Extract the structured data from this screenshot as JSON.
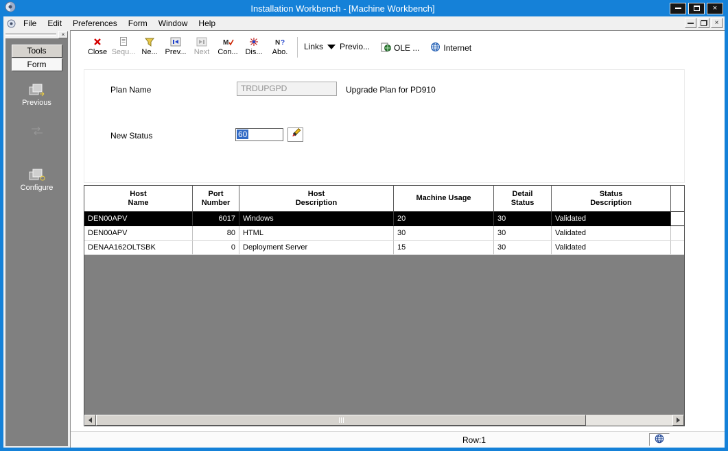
{
  "window": {
    "title": "Installation Workbench - [Machine Workbench]",
    "close_glyph": "×"
  },
  "menubar": {
    "items": [
      "File",
      "Edit",
      "Preferences",
      "Form",
      "Window",
      "Help"
    ],
    "child_close_glyph": "×",
    "handle_close_glyph": "×"
  },
  "sidebar": {
    "tabs": [
      {
        "label": "Tools"
      },
      {
        "label": "Form"
      }
    ],
    "items": [
      {
        "label": "Previous",
        "icon": "previous-pages-icon",
        "enabled": true
      },
      {
        "label": "",
        "icon": "inactive-exit-icon",
        "enabled": false
      },
      {
        "label": "Configure",
        "icon": "configure-pages-icon",
        "enabled": true
      }
    ]
  },
  "toolbar": {
    "buttons": [
      {
        "label": "Close",
        "icon": "close-x-icon",
        "enabled": true
      },
      {
        "label": "Sequ...",
        "icon": "sequence-icon",
        "enabled": false
      },
      {
        "label": "Ne...",
        "icon": "new-icon",
        "enabled": true
      },
      {
        "label": "Prev...",
        "icon": "previous-arrow-icon",
        "enabled": true
      },
      {
        "label": "Next",
        "icon": "next-arrow-icon",
        "enabled": false
      },
      {
        "label": "Con...",
        "icon": "confirm-icon",
        "enabled": true
      },
      {
        "label": "Dis...",
        "icon": "display-icon",
        "enabled": true
      },
      {
        "label": "Abo.",
        "icon": "about-icon",
        "enabled": true
      }
    ],
    "links_label": "Links",
    "links_selected": "Previo...",
    "ole_label": "OLE ...",
    "internet_label": "Internet"
  },
  "form": {
    "plan_name": {
      "label": "Plan Name",
      "value": "TRDUPGPD",
      "description": "Upgrade Plan for PD910"
    },
    "new_status": {
      "label": "New Status",
      "value": "60"
    }
  },
  "grid": {
    "columns": [
      {
        "line1": "Host",
        "line2": "Name"
      },
      {
        "line1": "Port",
        "line2": "Number"
      },
      {
        "line1": "Host",
        "line2": "Description"
      },
      {
        "line1": "Machine Usage",
        "line2": ""
      },
      {
        "line1": "Detail",
        "line2": "Status"
      },
      {
        "line1": "Status",
        "line2": "Description"
      }
    ],
    "rows": [
      [
        "DEN00APV",
        "6017",
        "Windows",
        "20",
        "30",
        "Validated"
      ],
      [
        "DEN00APV",
        "80",
        "HTML",
        "30",
        "30",
        "Validated"
      ],
      [
        "DENAA162OLTSBK",
        "0",
        "Deployment Server",
        "15",
        "30",
        "Validated"
      ]
    ],
    "selected_row_index": 0
  },
  "statusbar": {
    "row_label": "Row:1"
  }
}
